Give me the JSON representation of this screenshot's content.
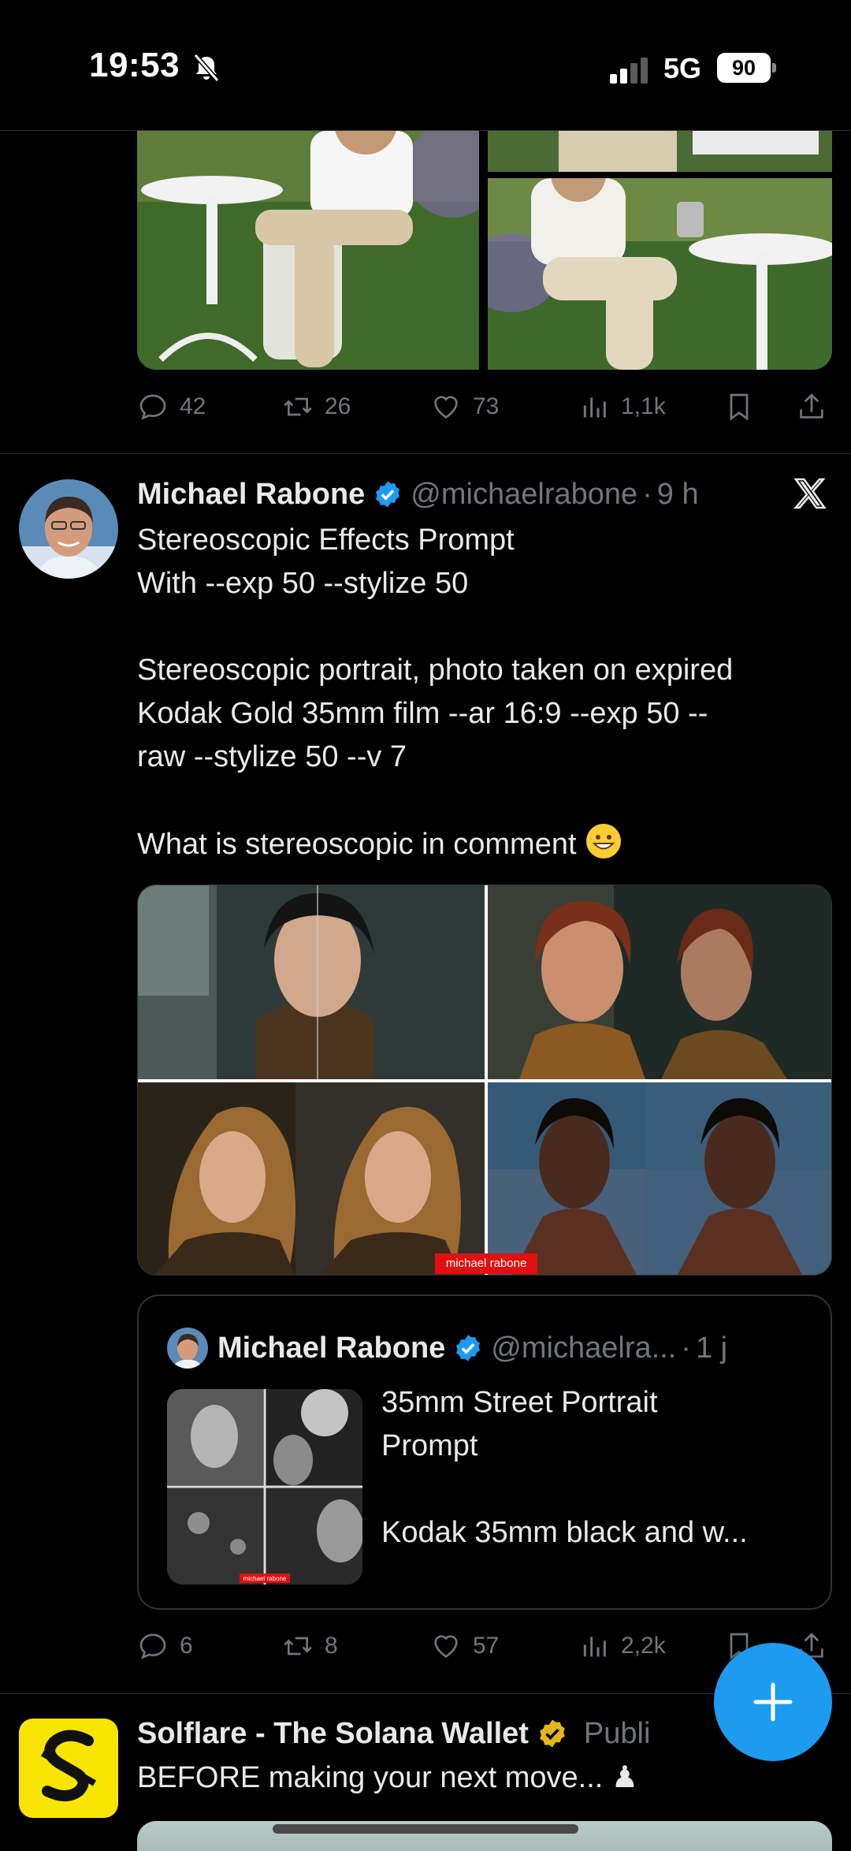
{
  "status_bar": {
    "time": "19:53",
    "network": "5G",
    "battery": "90",
    "icons": [
      "bell-slash-icon",
      "cellular-signal-icon",
      "battery-icon"
    ]
  },
  "tweet1": {
    "actions": {
      "replies": "42",
      "reposts": "26",
      "likes": "73",
      "views": "1,1k"
    }
  },
  "tweet2": {
    "name": "Michael Rabone",
    "handle": "@michaelrabone",
    "separator": "·",
    "time": "9 h",
    "text_lines": [
      "Stereoscopic Effects Prompt",
      "With --exp 50 --stylize 50",
      "",
      "Stereoscopic portrait, photo taken on expired",
      "Kodak Gold 35mm film --ar 16:9 --exp 50 --",
      "raw --stylize 50 --v 7",
      "",
      "What is stereoscopic in comment"
    ],
    "watermark": "michael rabone",
    "quote": {
      "name": "Michael Rabone",
      "handle": "@michaelra...",
      "separator": "·",
      "time": "1 j",
      "text_lines": [
        "35mm Street Portrait",
        "Prompt",
        "",
        "Kodak 35mm black and w..."
      ],
      "thumb_watermark": "michael rabone"
    },
    "actions": {
      "replies": "6",
      "reposts": "8",
      "likes": "57",
      "views": "2,2k"
    }
  },
  "ad": {
    "name": "Solflare - The Solana Wallet",
    "tag": "Publi",
    "text": "BEFORE making your next move... ♟"
  },
  "colors": {
    "background": "#000000",
    "text": "#e7e9ea",
    "secondary": "#71767b",
    "accent": "#1d9bf0",
    "divider": "#2f3336",
    "ad_brand": "#f7e500"
  }
}
